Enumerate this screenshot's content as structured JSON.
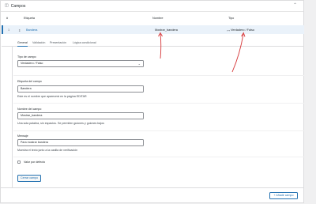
{
  "panel": {
    "title": "Campos",
    "collapse_icon": "chevron-up-icon",
    "title_icon": "fields-icon"
  },
  "table": {
    "headers": [
      "#",
      "Etiqueta",
      "Nombre",
      "Tipo"
    ],
    "row": {
      "num": "1",
      "label": "Bandera",
      "name": "Mostrar_bandera",
      "type": "Verdadero / Falso"
    }
  },
  "tabs": [
    "General",
    "Validación",
    "Presentación",
    "Lógica condicional"
  ],
  "fields": {
    "type_label": "Tipo de campo",
    "type_value": "Verdadero / Falso",
    "label_label": "Etiqueta del campo",
    "label_value": "Bandera",
    "label_help": "Este es el nombre que aparecerá en la página EDITAR",
    "name_label": "Nombre del campo",
    "name_value": "Mostrar_bandera",
    "name_help": "Una sola palabra, sin espacios. Se permiten guiones y guiones bajos",
    "message_label": "Mensaje",
    "message_value": "Para mostrar bandera",
    "message_help": "Muestra el texto junto a la casilla de verificación",
    "default_label": "Valor por defecto"
  },
  "buttons": {
    "close": "Cerrar campo",
    "add": "+ Añadir campo"
  },
  "colors": {
    "accent": "#2271b1",
    "arrow": "#d63638",
    "row_bg": "#eaf2fa"
  }
}
